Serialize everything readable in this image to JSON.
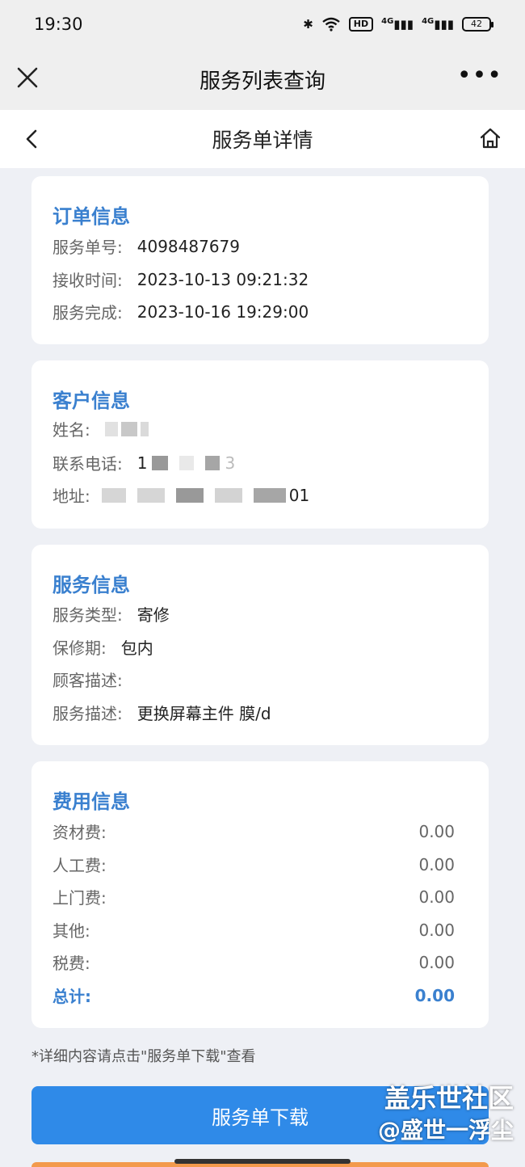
{
  "status_bar": {
    "time": "19:30",
    "icons": [
      "bluetooth-icon",
      "wifi-icon",
      "hd-icon",
      "signal-4g-icon",
      "signal-4g-icon"
    ],
    "hd_label": "HD",
    "network_1": "4G",
    "network_2": "4G",
    "battery": "42"
  },
  "title_bar": {
    "title": "服务列表查询",
    "more": "•••"
  },
  "nav_bar": {
    "title": "服务单详情"
  },
  "order_info": {
    "heading": "订单信息",
    "rows": [
      {
        "label": "服务单号:",
        "value": "4098487679"
      },
      {
        "label": "接收时间:",
        "value": "2023-10-13 09:21:32"
      },
      {
        "label": "服务完成:",
        "value": "2023-10-16 19:29:00"
      }
    ]
  },
  "customer_info": {
    "heading": "客户信息",
    "name_label": "姓名:",
    "phone_label": "联系电话:",
    "phone_prefix": "1",
    "phone_suffix": "3",
    "address_label": "地址:",
    "address_suffix": "01"
  },
  "service_info": {
    "heading": "服务信息",
    "rows": [
      {
        "label": "服务类型:",
        "value": "寄修"
      },
      {
        "label": "保修期:",
        "value": "包内"
      },
      {
        "label": "顾客描述:",
        "value": ""
      },
      {
        "label": "服务描述:",
        "value": "更换屏幕主件 膜/d"
      }
    ]
  },
  "fee_info": {
    "heading": "费用信息",
    "rows": [
      {
        "label": "资材费:",
        "value": "0.00"
      },
      {
        "label": "人工费:",
        "value": "0.00"
      },
      {
        "label": "上门费:",
        "value": "0.00"
      },
      {
        "label": "其他:",
        "value": "0.00"
      },
      {
        "label": "税费:",
        "value": "0.00"
      }
    ],
    "total_label": "总计:",
    "total_value": "0.00"
  },
  "note": "*详细内容请点击\"服务单下载\"查看",
  "download_button": "服务单下载",
  "watermark": {
    "line1": "盖乐世社区",
    "line2": "@盛世一浮尘"
  },
  "colors": {
    "accent": "#3a80cf",
    "button": "#2f8ae8",
    "background": "#eef0f5"
  }
}
